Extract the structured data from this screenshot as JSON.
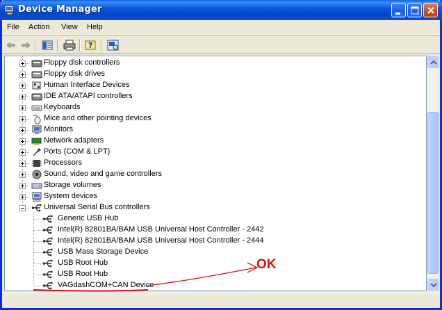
{
  "window": {
    "title": "Device Manager"
  },
  "menubar": {
    "items": [
      "File",
      "Action",
      "View",
      "Help"
    ]
  },
  "toolbar": {
    "buttons": [
      "back-icon",
      "forward-icon",
      "properties-icon",
      "print-icon",
      "help-icon",
      "scan-hardware-icon"
    ]
  },
  "tree": {
    "categories": [
      {
        "label": "Floppy disk controllers",
        "icon": "floppy-controller-icon",
        "expanded": false
      },
      {
        "label": "Floppy disk drives",
        "icon": "floppy-drive-icon",
        "expanded": false
      },
      {
        "label": "Human Interface Devices",
        "icon": "hid-icon",
        "expanded": false
      },
      {
        "label": "IDE ATA/ATAPI controllers",
        "icon": "ide-controller-icon",
        "expanded": false
      },
      {
        "label": "Keyboards",
        "icon": "keyboard-icon",
        "expanded": false
      },
      {
        "label": "Mice and other pointing devices",
        "icon": "mouse-icon",
        "expanded": false
      },
      {
        "label": "Monitors",
        "icon": "monitor-icon",
        "expanded": false
      },
      {
        "label": "Network adapters",
        "icon": "network-adapter-icon",
        "expanded": false
      },
      {
        "label": "Ports (COM & LPT)",
        "icon": "port-icon",
        "expanded": false
      },
      {
        "label": "Processors",
        "icon": "processor-icon",
        "expanded": false
      },
      {
        "label": "Sound, video and game controllers",
        "icon": "sound-icon",
        "expanded": false
      },
      {
        "label": "Storage volumes",
        "icon": "storage-volume-icon",
        "expanded": false
      },
      {
        "label": "System devices",
        "icon": "system-device-icon",
        "expanded": false
      },
      {
        "label": "Universal Serial Bus controllers",
        "icon": "usb-icon",
        "expanded": true
      }
    ],
    "usb_children": [
      "Generic USB Hub",
      "Intel(R) 82801BA/BAM USB Universal Host Controller - 2442",
      "Intel(R) 82801BA/BAM USB Universal Host Controller - 2444",
      "USB Mass Storage Device",
      "USB Root Hub",
      "USB Root Hub",
      "VAGdashCOM+CAN Device"
    ]
  },
  "annotation": {
    "text": "OK",
    "color": "#e01010"
  },
  "colors": {
    "titlebar": "#0a58dd",
    "window_bg": "#ece9d8",
    "tree_bg": "#ffffff"
  }
}
